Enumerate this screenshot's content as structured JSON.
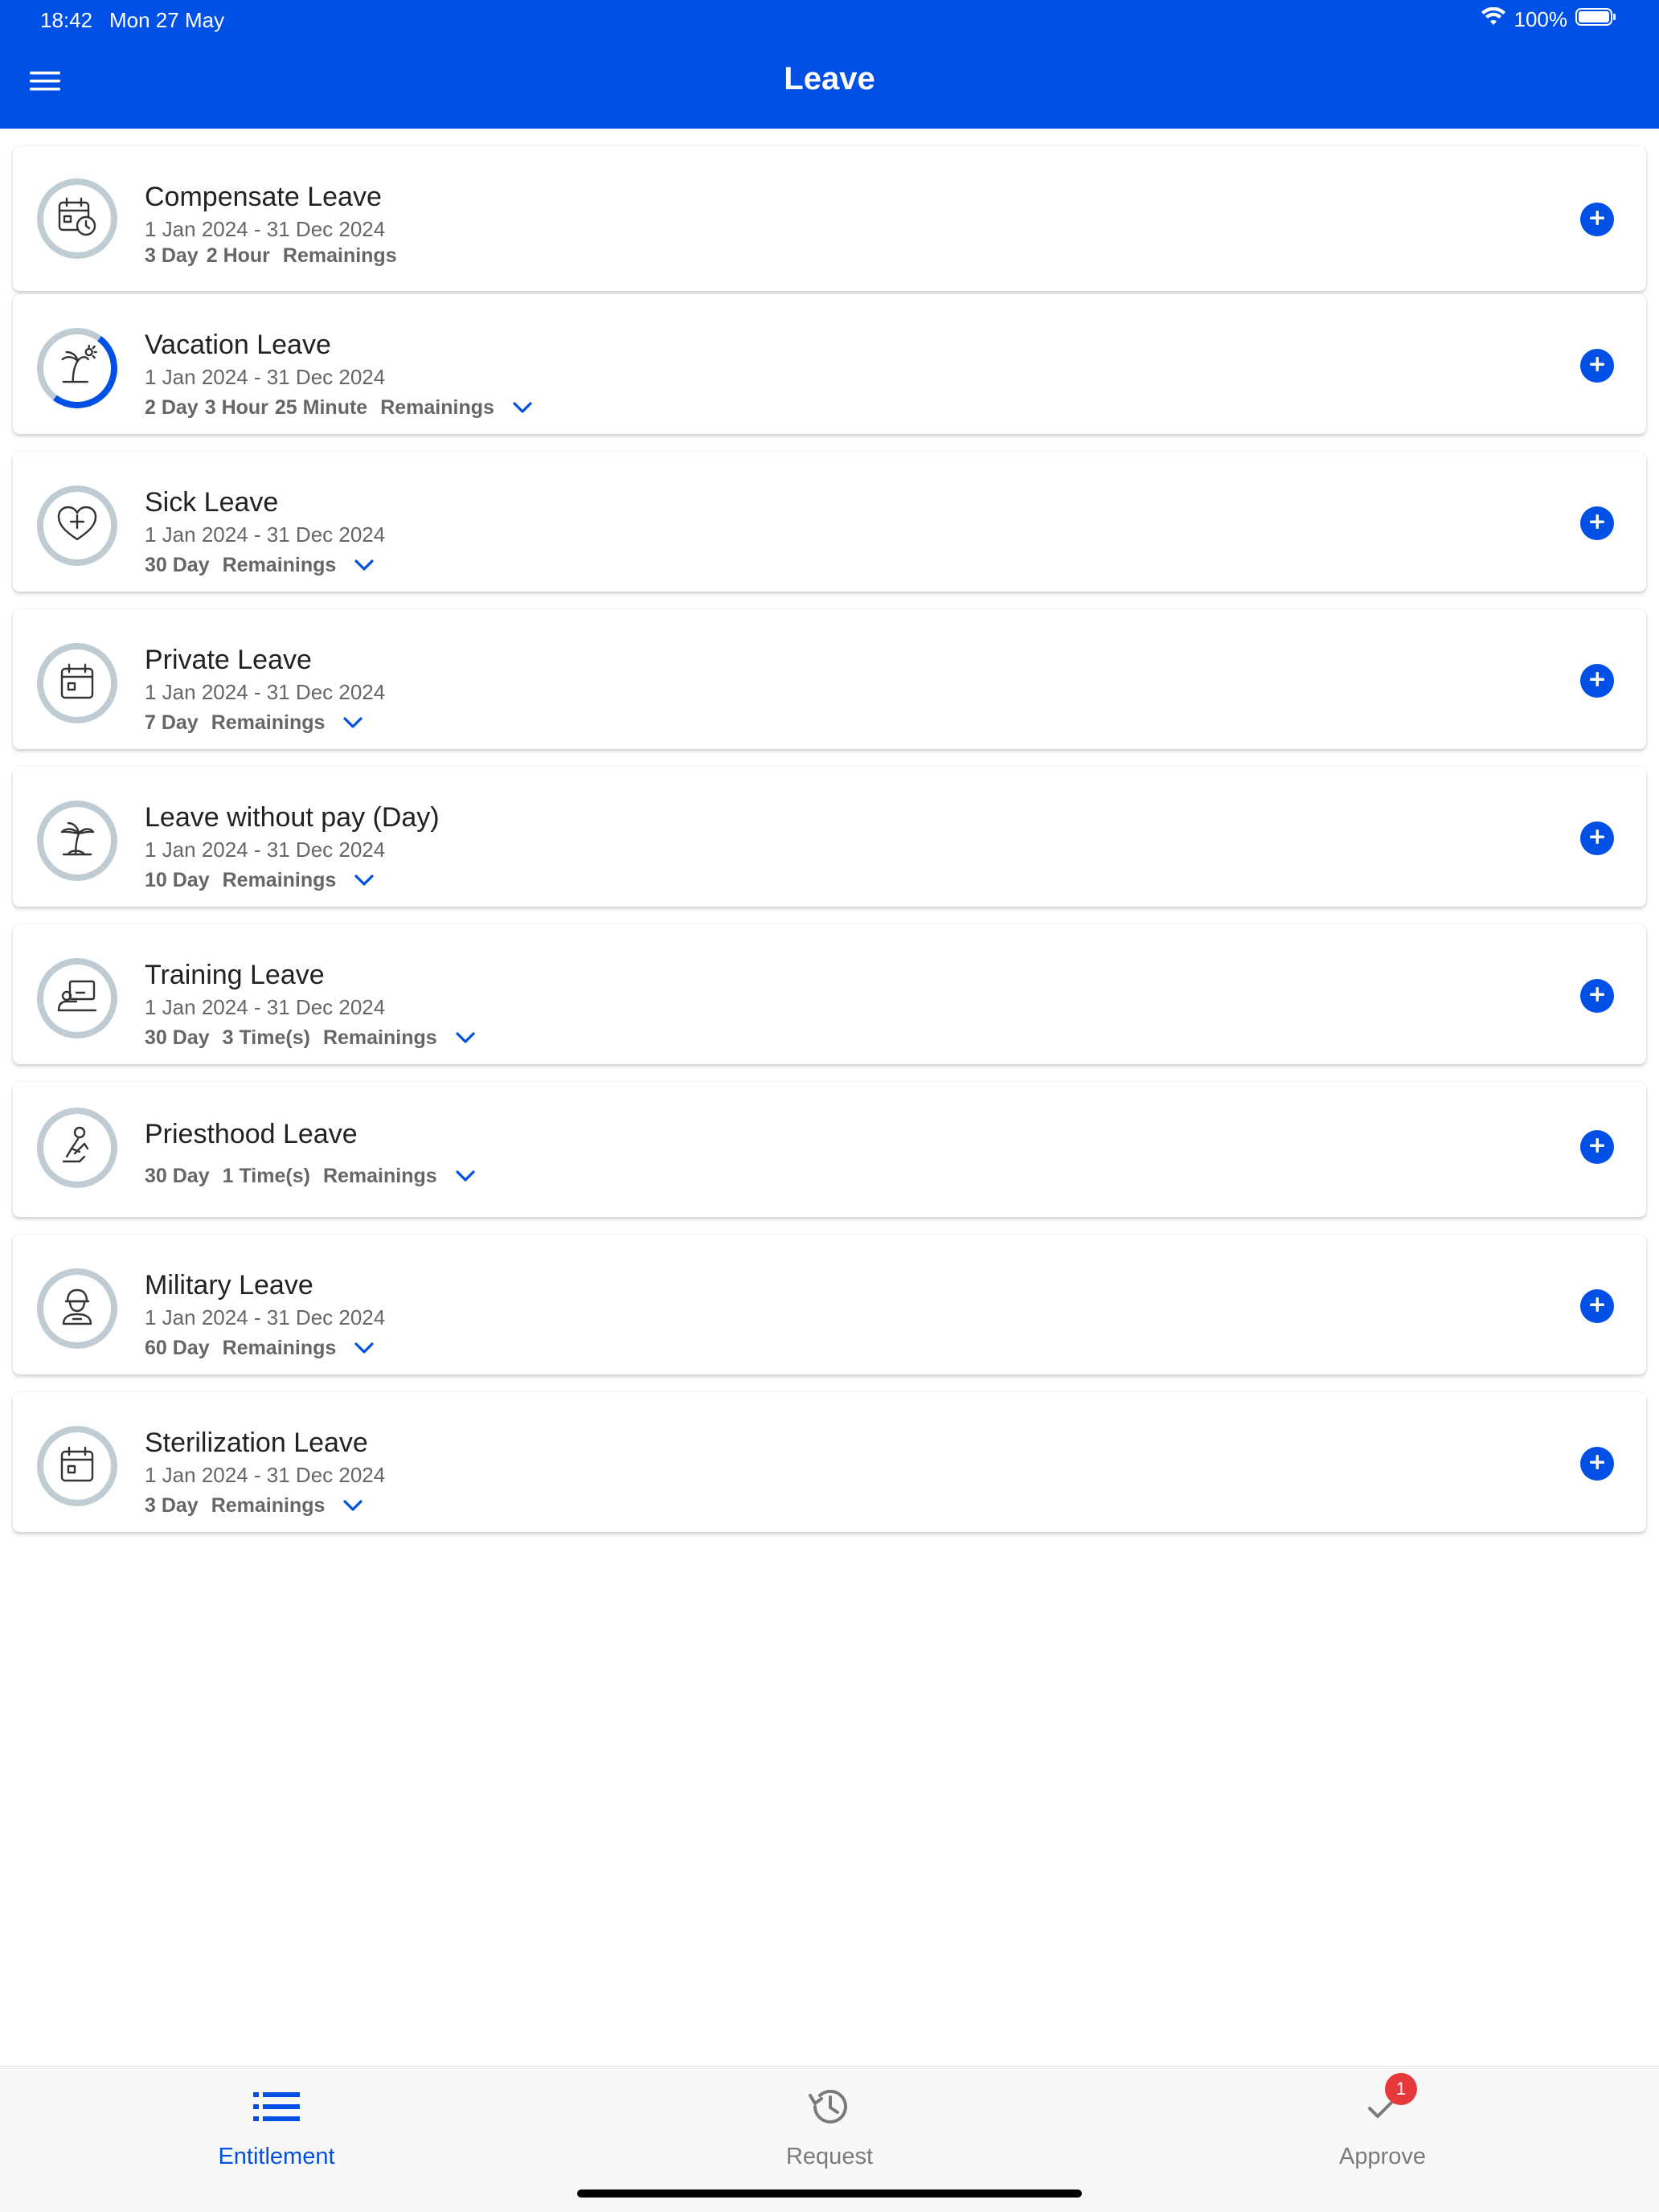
{
  "status_bar": {
    "time": "18:42",
    "date": "Mon 27 May",
    "battery": "100%"
  },
  "header": {
    "title": "Leave"
  },
  "leaves": [
    {
      "title": "Compensate Leave",
      "period": "1 Jan 2024 - 31 Dec 2024",
      "amounts": [
        "3 Day",
        "2 Hour"
      ],
      "remaining_label": "Remainings",
      "expandable": false,
      "icon": "calendar-clock-icon"
    },
    {
      "title": "Vacation Leave",
      "period": "1 Jan 2024 - 31 Dec 2024",
      "amounts": [
        "2 Day",
        "3 Hour",
        "25 Minute"
      ],
      "remaining_label": "Remainings",
      "expandable": true,
      "icon": "beach-palm-icon",
      "used_fraction": 0.15
    },
    {
      "title": "Sick Leave",
      "period": "1 Jan 2024 - 31 Dec 2024",
      "amounts": [
        "30 Day"
      ],
      "remaining_label": "Remainings",
      "expandable": true,
      "icon": "heart-plus-icon"
    },
    {
      "title": "Private Leave",
      "period": "1 Jan 2024 - 31 Dec 2024",
      "amounts": [
        "7 Day"
      ],
      "remaining_label": "Remainings",
      "expandable": true,
      "icon": "calendar-icon"
    },
    {
      "title": "Leave without pay (Day)",
      "period": "1 Jan 2024 - 31 Dec 2024",
      "amounts": [
        "10 Day"
      ],
      "remaining_label": "Remainings",
      "expandable": true,
      "icon": "palm-tree-icon"
    },
    {
      "title": "Training Leave",
      "period": "1 Jan 2024 - 31 Dec 2024",
      "amounts": [
        "30 Day",
        "3 Time(s)"
      ],
      "remaining_label": "Remainings",
      "expandable": true,
      "icon": "presentation-icon"
    },
    {
      "title": "Priesthood Leave",
      "period": "",
      "amounts": [
        "30 Day",
        "1 Time(s)"
      ],
      "remaining_label": "Remainings",
      "expandable": true,
      "icon": "monk-icon"
    },
    {
      "title": "Military Leave",
      "period": "1 Jan 2024 - 31 Dec 2024",
      "amounts": [
        "60 Day"
      ],
      "remaining_label": "Remainings",
      "expandable": true,
      "icon": "soldier-icon"
    },
    {
      "title": "Sterilization Leave",
      "period": "1 Jan 2024 - 31 Dec 2024",
      "amounts": [
        "3 Day"
      ],
      "remaining_label": "Remainings",
      "expandable": true,
      "icon": "calendar-icon"
    }
  ],
  "tabs": [
    {
      "label": "Entitlement",
      "icon": "list-icon",
      "active": true
    },
    {
      "label": "Request",
      "icon": "history-icon",
      "active": false
    },
    {
      "label": "Approve",
      "icon": "check-icon",
      "active": false,
      "badge": "1"
    }
  ],
  "colors": {
    "primary": "#0050e6",
    "ring": "#bfccd3",
    "badge": "#e5393b"
  }
}
